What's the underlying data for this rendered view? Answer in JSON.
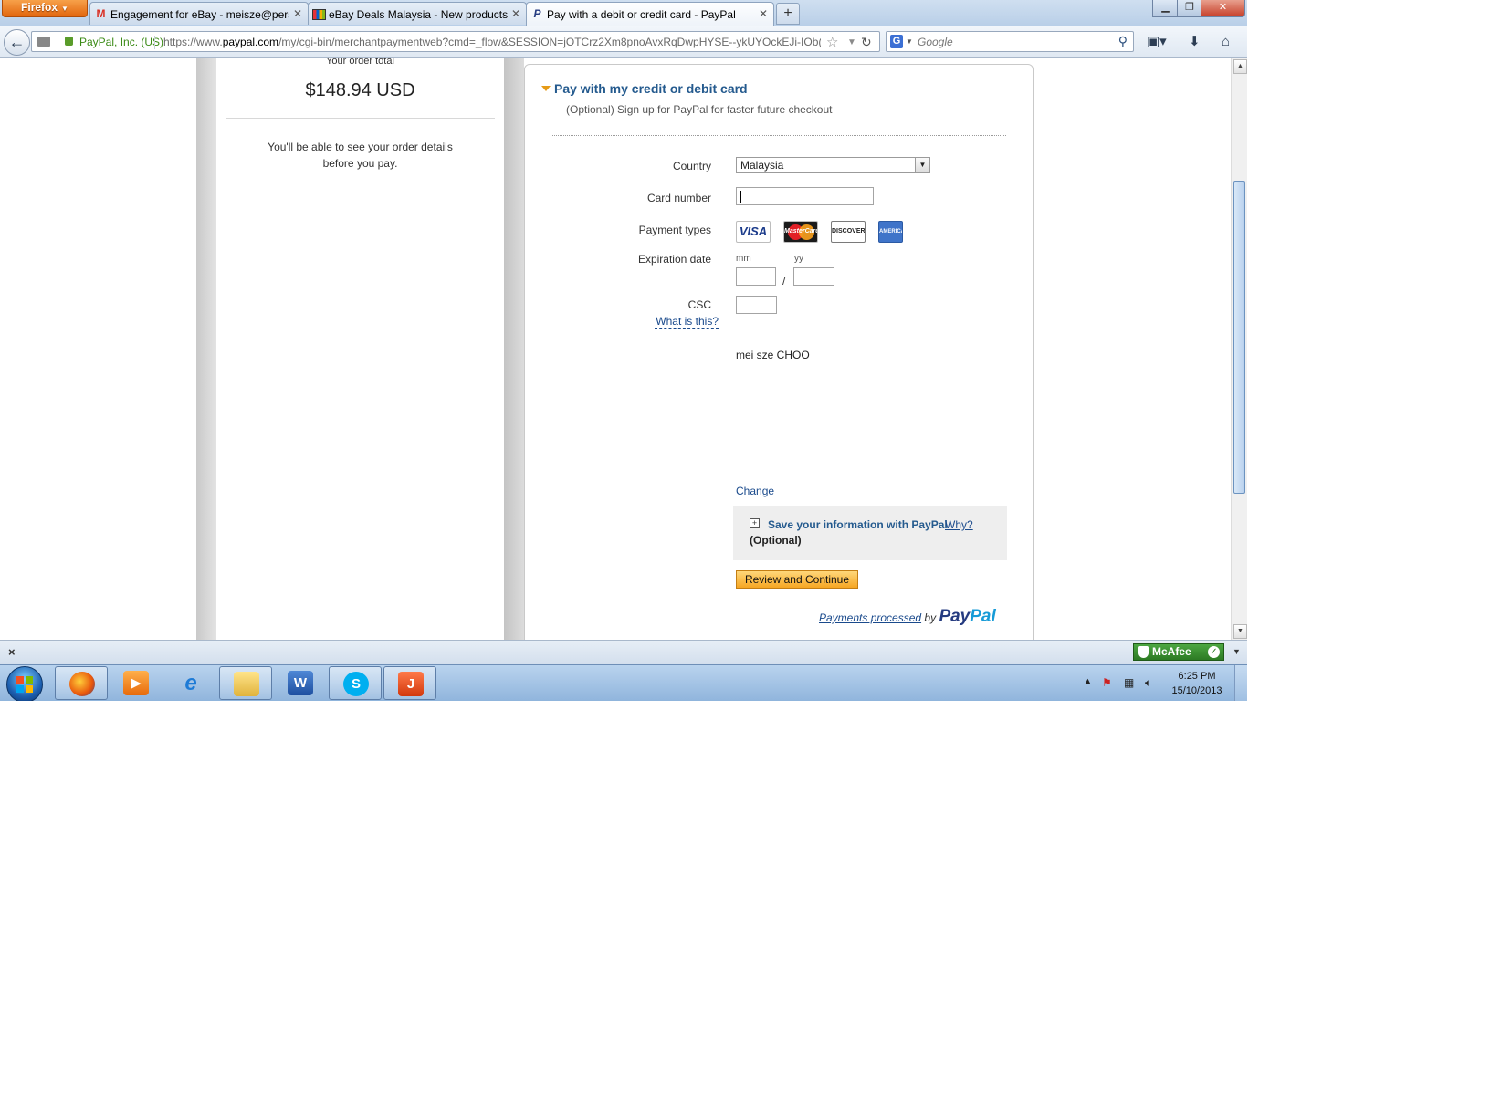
{
  "browser": {
    "menu_button": "Firefox",
    "tabs": [
      {
        "label": "Engagement for eBay - meisze@pers...",
        "favicon": "gmail-icon",
        "active": false
      },
      {
        "label": "eBay Deals Malaysia - New products ...",
        "favicon": "ebay-icon",
        "active": false
      },
      {
        "label": "Pay with a debit or credit card - PayPal",
        "favicon": "paypal-icon",
        "active": true
      }
    ],
    "new_tab": "+",
    "site_identity": "PayPal, Inc. (US)",
    "url_prefix": "https://www.",
    "url_domain": "paypal.com",
    "url_rest": "/my/cgi-bin/merchantpaymentweb?cmd=_flow&SESSION=jOTCrz2Xm8pnoAvxRqDwpHYSE--ykUYOckEJi-IOb(",
    "search_placeholder": "Google",
    "search_engine": "G"
  },
  "order": {
    "total_label": "Your order total",
    "total_value": "$148.94 USD",
    "note": "You'll be able to see your order details before you pay."
  },
  "form": {
    "title": "Pay with my credit or debit card",
    "subtitle": "(Optional) Sign up for PayPal for faster future checkout",
    "country_label": "Country",
    "country_value": "Malaysia",
    "card_number_label": "Card number",
    "payment_types_label": "Payment types",
    "card_visa": "VISA",
    "card_mastercard": "MasterCard",
    "card_discover": "DISCOVER",
    "card_amex": "AMERICAN EXPRESS",
    "expiration_label": "Expiration date",
    "mm_label": "mm",
    "yy_label": "yy",
    "exp_separator": "/",
    "csc_label": "CSC",
    "what_is_this": "What is this?",
    "name": "mei sze CHOO",
    "change_link": "Change",
    "save_title": "Save your information with PayPal",
    "save_why": "Why?",
    "save_optional": "(Optional)",
    "review_button": "Review and Continue",
    "processed_text": "Payments processed",
    "processed_by": "by",
    "processed_brand_1": "Pay",
    "processed_brand_2": "Pal"
  },
  "addon_bar": {
    "close": "×",
    "mcafee_label": "McAfee"
  },
  "taskbar": {
    "clock_time": "6:25 PM",
    "clock_date": "15/10/2013"
  }
}
